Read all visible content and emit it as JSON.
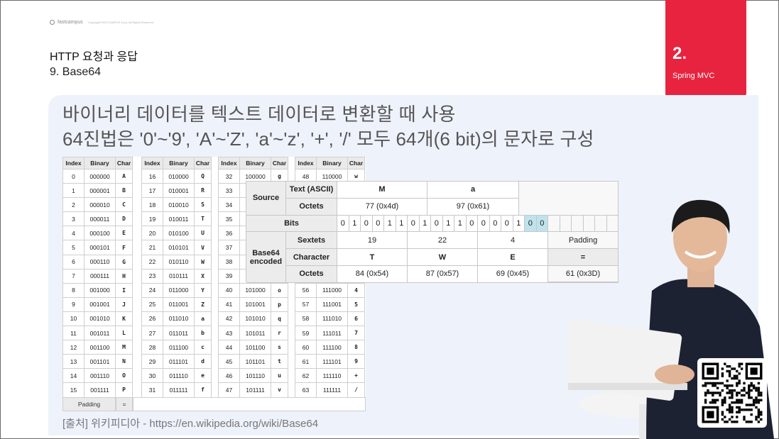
{
  "header": {
    "logo_text": "fastcampus",
    "copyright": "Copyright FASTCAMPUS Corp. All Rights Reserved",
    "title": "HTTP 요청과 응답",
    "subtitle": "9. Base64"
  },
  "chapter": {
    "number": "2",
    "dot": ".",
    "name": "Spring MVC",
    "accent_color": "#e8233f"
  },
  "body": {
    "line1": "바이너리 데이터를 텍스트 데이터로 변환할 때 사용",
    "line2": "64진법은 '0'~'9', 'A'~'Z', 'a'~'z', '+', '/' 모두 64개(6 bit)의 문자로 구성"
  },
  "index_table": {
    "headers": [
      "Index",
      "Binary",
      "Char"
    ],
    "rows": [
      [
        "0",
        "000000",
        "A"
      ],
      [
        "1",
        "000001",
        "B"
      ],
      [
        "2",
        "000010",
        "C"
      ],
      [
        "3",
        "000011",
        "D"
      ],
      [
        "4",
        "000100",
        "E"
      ],
      [
        "5",
        "000101",
        "F"
      ],
      [
        "6",
        "000110",
        "G"
      ],
      [
        "7",
        "000111",
        "H"
      ],
      [
        "8",
        "001000",
        "I"
      ],
      [
        "9",
        "001001",
        "J"
      ],
      [
        "10",
        "001010",
        "K"
      ],
      [
        "11",
        "001011",
        "L"
      ],
      [
        "12",
        "001100",
        "M"
      ],
      [
        "13",
        "001101",
        "N"
      ],
      [
        "14",
        "001110",
        "O"
      ],
      [
        "15",
        "001111",
        "P"
      ],
      [
        "16",
        "010000",
        "Q"
      ],
      [
        "17",
        "010001",
        "R"
      ],
      [
        "18",
        "010010",
        "S"
      ],
      [
        "19",
        "010011",
        "T"
      ],
      [
        "20",
        "010100",
        "U"
      ],
      [
        "21",
        "010101",
        "V"
      ],
      [
        "22",
        "010110",
        "W"
      ],
      [
        "23",
        "010111",
        "X"
      ],
      [
        "24",
        "011000",
        "Y"
      ],
      [
        "25",
        "011001",
        "Z"
      ],
      [
        "26",
        "011010",
        "a"
      ],
      [
        "27",
        "011011",
        "b"
      ],
      [
        "28",
        "011100",
        "c"
      ],
      [
        "29",
        "011101",
        "d"
      ],
      [
        "30",
        "011110",
        "e"
      ],
      [
        "31",
        "011111",
        "f"
      ],
      [
        "32",
        "100000",
        "g"
      ],
      [
        "33",
        "",
        ""
      ],
      [
        "34",
        "",
        ""
      ],
      [
        "35",
        "",
        ""
      ],
      [
        "36",
        "",
        ""
      ],
      [
        "37",
        "",
        ""
      ],
      [
        "38",
        "",
        ""
      ],
      [
        "39",
        "",
        ""
      ],
      [
        "40",
        "101000",
        "o"
      ],
      [
        "41",
        "101001",
        "p"
      ],
      [
        "42",
        "101010",
        "q"
      ],
      [
        "43",
        "101011",
        "r"
      ],
      [
        "44",
        "101100",
        "s"
      ],
      [
        "45",
        "101101",
        "t"
      ],
      [
        "46",
        "101110",
        "u"
      ],
      [
        "47",
        "101111",
        "v"
      ],
      [
        "48",
        "110000",
        "w"
      ],
      [
        "",
        "",
        ""
      ],
      [
        "",
        "",
        ""
      ],
      [
        "",
        "",
        ""
      ],
      [
        "",
        "",
        ""
      ],
      [
        "",
        "",
        ""
      ],
      [
        "",
        "",
        ""
      ],
      [
        "",
        "",
        ""
      ],
      [
        "56",
        "111000",
        "4"
      ],
      [
        "57",
        "111001",
        "5"
      ],
      [
        "58",
        "111010",
        "6"
      ],
      [
        "59",
        "111011",
        "7"
      ],
      [
        "60",
        "111100",
        "8"
      ],
      [
        "61",
        "111101",
        "9"
      ],
      [
        "62",
        "111110",
        "+"
      ],
      [
        "63",
        "111111",
        "/"
      ]
    ],
    "padding_label": "Padding",
    "padding_char": "="
  },
  "encoding_table": {
    "source": "Source",
    "text_ascii": "Text (ASCII)",
    "char_m": "M",
    "char_a": "a",
    "octets": "Octets",
    "oct_m": "77 (0x4d)",
    "oct_a": "97 (0x61)",
    "bits": "Bits",
    "bit_values": [
      "0",
      "1",
      "0",
      "0",
      "1",
      "1",
      "0",
      "1",
      "0",
      "1",
      "1",
      "0",
      "0",
      "0",
      "0",
      "1",
      "0",
      "0",
      "",
      "",
      "",
      "",
      "",
      ""
    ],
    "base64_encoded": "Base64 encoded",
    "sextets": "Sextets",
    "sextet_values": [
      "19",
      "22",
      "4",
      "Padding"
    ],
    "character": "Character",
    "char_values": [
      "T",
      "W",
      "E",
      "="
    ],
    "octets_values": [
      "84 (0x54)",
      "87 (0x57)",
      "69 (0x45)",
      "61 (0x3D)"
    ]
  },
  "source_credit": "[출처] 위키피디아 - https://en.wikipedia.org/wiki/Base64"
}
